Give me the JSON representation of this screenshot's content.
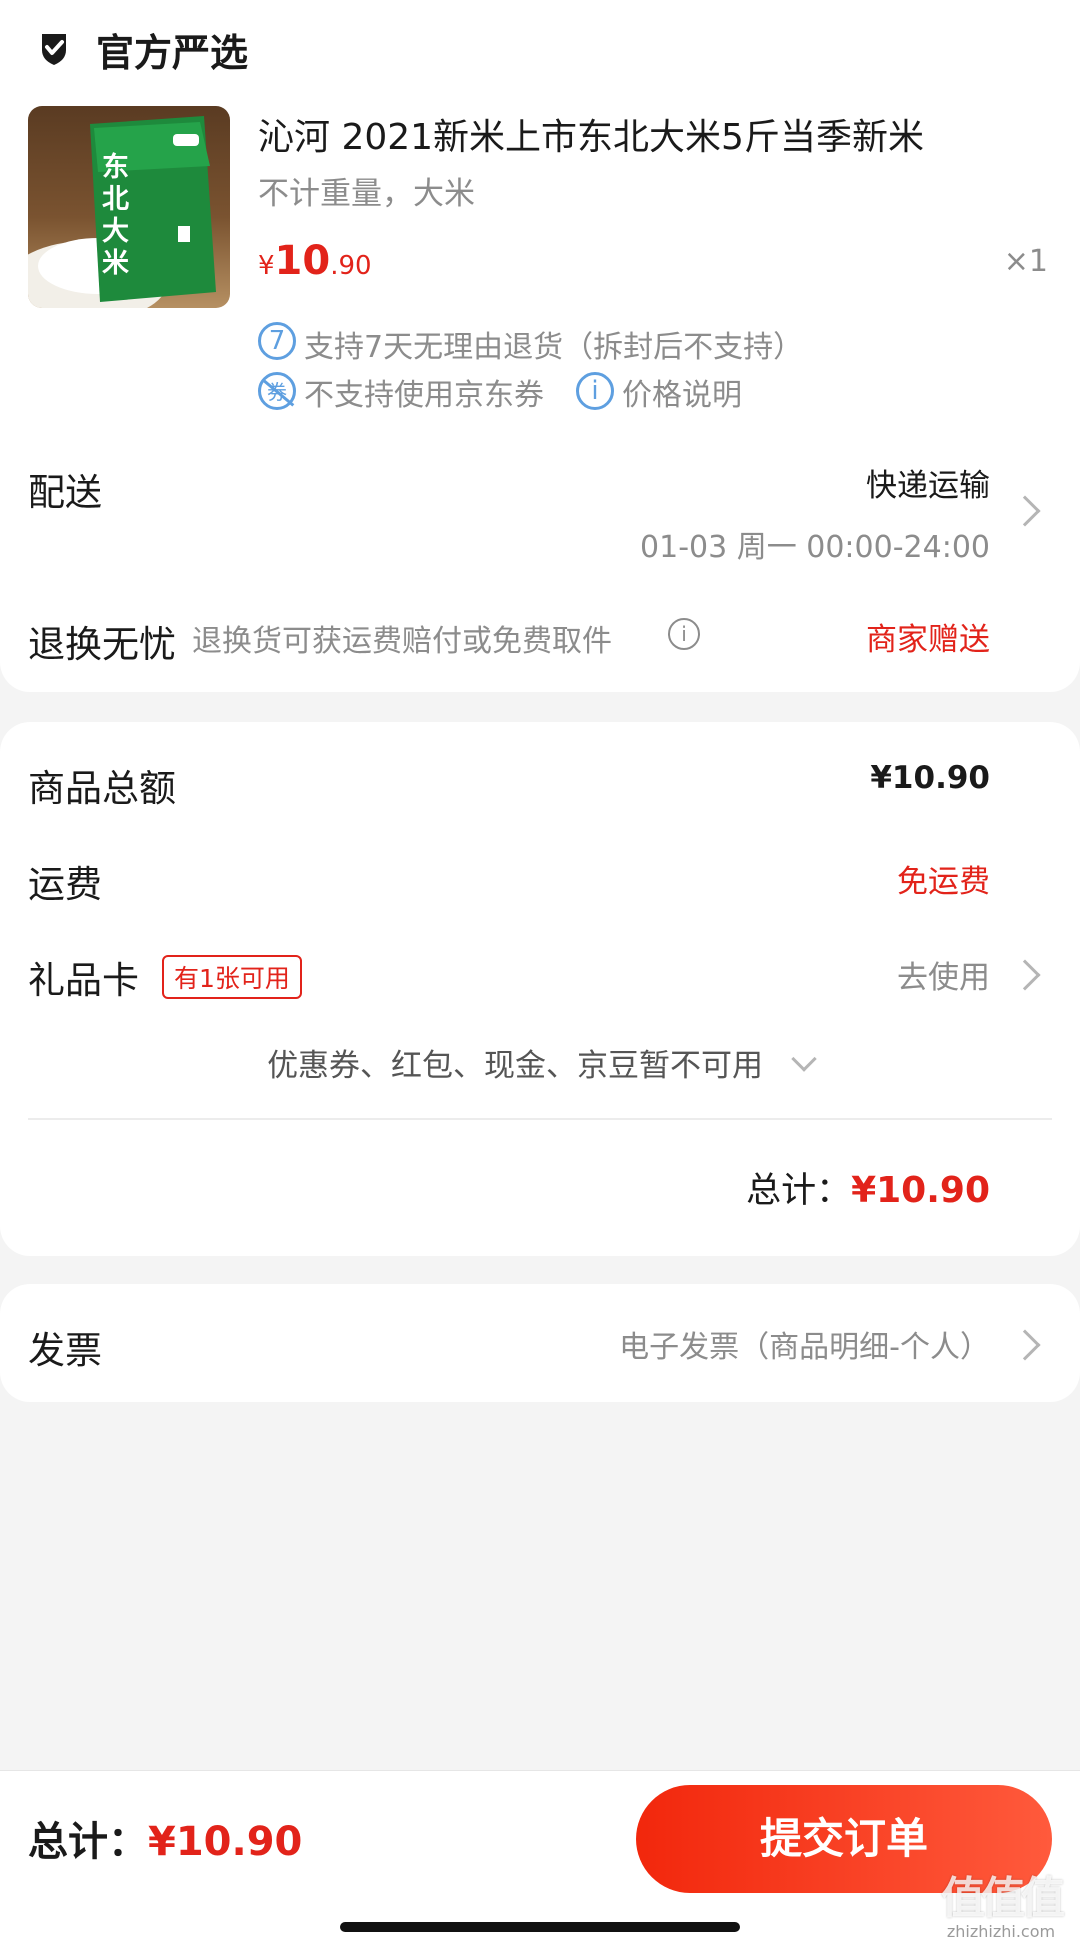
{
  "store": {
    "badge_title": "官方严选"
  },
  "product": {
    "name": "沁河 2021新米上市东北大米5斤当季新米",
    "spec": "不计重量，大米",
    "price_symbol": "¥",
    "price_int": "10",
    "price_dec": ".90",
    "qty": "×1",
    "image_label": "东北大米",
    "service_return": "支持7天无理由退货（拆封后不支持）",
    "service_return_icon_text": "7",
    "service_coupon": "不支持使用京东券",
    "service_coupon_icon_text": "券",
    "price_note": "价格说明",
    "price_note_icon_text": "i"
  },
  "delivery": {
    "label": "配送",
    "method": "快递运输",
    "time": "01-03 周一 00:00-24:00"
  },
  "returns": {
    "label": "退换无忧",
    "desc": "退换货可获运费赔付或免费取件",
    "value": "商家赠送",
    "info_icon_text": "i"
  },
  "summary": {
    "goods_total_label": "商品总额",
    "goods_total_value": "¥10.90",
    "shipping_label": "运费",
    "shipping_value": "免运费",
    "giftcard_label": "礼品卡",
    "giftcard_badge": "有1张可用",
    "giftcard_action": "去使用",
    "unavailable_note": "优惠券、红包、现金、京豆暂不可用",
    "total_label": "总计：",
    "total_value": "¥10.90"
  },
  "invoice": {
    "label": "发票",
    "value": "电子发票（商品明细-个人）"
  },
  "bottom_bar": {
    "total_label": "总计：",
    "total_value": "¥10.90",
    "submit_label": "提交订单"
  },
  "watermark": {
    "text": "值值值",
    "sub": "zhizhizhi.com"
  },
  "colors": {
    "accent_red": "#e2231a",
    "submit_gradient_start": "#f2270c",
    "submit_gradient_end": "#ff5a3c",
    "service_blue": "#5e9fe0"
  }
}
